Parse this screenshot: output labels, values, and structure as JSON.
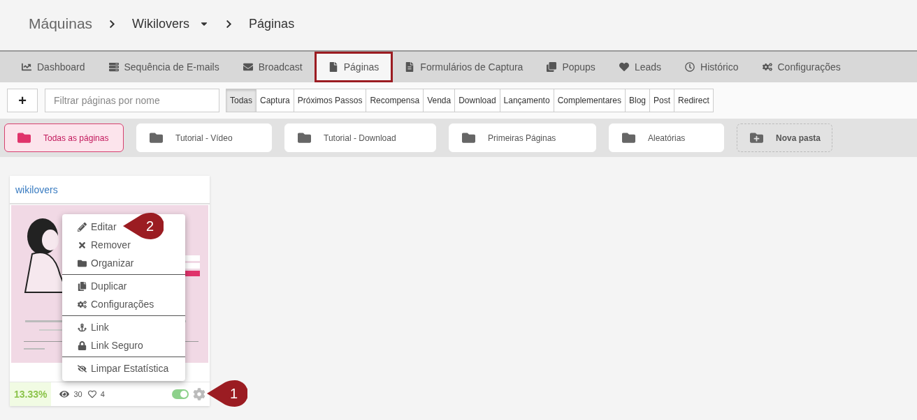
{
  "breadcrumb": {
    "root": "Máquinas",
    "machine": "Wikilovers",
    "current": "Páginas"
  },
  "nav_tabs": [
    {
      "label": "Dashboard",
      "selected": false
    },
    {
      "label": "Sequência de E-mails",
      "selected": false
    },
    {
      "label": "Broadcast",
      "selected": false
    },
    {
      "label": "Páginas",
      "selected": true
    },
    {
      "label": "Formulários de Captura",
      "selected": false
    },
    {
      "label": "Popups",
      "selected": false
    },
    {
      "label": "Leads",
      "selected": false
    },
    {
      "label": "Histórico",
      "selected": false
    },
    {
      "label": "Configurações",
      "selected": false
    }
  ],
  "toolbar": {
    "add_button": "+",
    "search": {
      "placeholder": "Filtrar páginas por nome"
    },
    "filters": [
      {
        "label": "Todas",
        "selected": true
      },
      {
        "label": "Captura",
        "selected": false
      },
      {
        "label": "Próximos Passos",
        "selected": false
      },
      {
        "label": "Recompensa",
        "selected": false
      },
      {
        "label": "Venda",
        "selected": false
      },
      {
        "label": "Download",
        "selected": false
      },
      {
        "label": "Lançamento",
        "selected": false
      },
      {
        "label": "Complementares",
        "selected": false
      },
      {
        "label": "Blog",
        "selected": false
      },
      {
        "label": "Post",
        "selected": false
      },
      {
        "label": "Redirect",
        "selected": false
      }
    ]
  },
  "folders": [
    {
      "label": "Todas as páginas",
      "kind": "folder",
      "selected": true
    },
    {
      "label": "Tutorial - Vídeo",
      "kind": "folder",
      "selected": false
    },
    {
      "label": "Tutorial - Download",
      "kind": "folder",
      "selected": false
    },
    {
      "label": "Primeiras Páginas",
      "kind": "folder",
      "selected": false
    },
    {
      "label": "Aleatórias",
      "kind": "folder",
      "selected": false
    },
    {
      "label": "Nova pasta",
      "kind": "new",
      "selected": false
    }
  ],
  "page_card": {
    "title": "wikilovers",
    "conversion": "13.33%",
    "views": "30",
    "likes": "4",
    "active": true
  },
  "context_menu": {
    "groups": [
      {
        "items": [
          {
            "label": "Editar"
          },
          {
            "label": "Remover"
          },
          {
            "label": "Organizar"
          }
        ]
      },
      {
        "items": [
          {
            "label": "Duplicar"
          },
          {
            "label": "Configurações"
          }
        ]
      },
      {
        "items": [
          {
            "label": "Link"
          },
          {
            "label": "Link Seguro"
          }
        ]
      },
      {
        "items": [
          {
            "label": "Limpar Estatística"
          }
        ]
      }
    ]
  },
  "callouts": [
    {
      "label": "1"
    },
    {
      "label": "2"
    }
  ]
}
